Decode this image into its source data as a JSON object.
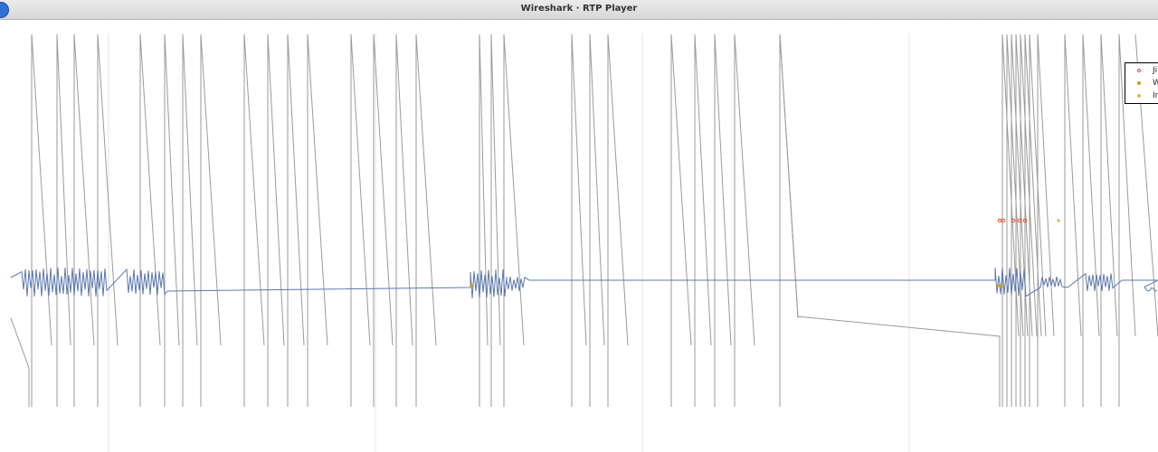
{
  "window": {
    "title": "Wireshark · RTP Player"
  },
  "legend": {
    "items": [
      {
        "label": "Ji",
        "color": "#e05030",
        "marker": "circle-outline"
      },
      {
        "label": "W",
        "color": "#c8a020",
        "marker": "dot"
      },
      {
        "label": "In",
        "color": "#e8b840",
        "marker": "dot"
      }
    ]
  },
  "colors": {
    "sequence_line": "#9a9a9a",
    "waveform": "#5b78b0",
    "grid": "#e4e4e4",
    "jitter_marker": "#e05030",
    "wrong_seq_marker": "#c8a020",
    "inserted_marker": "#e8b840"
  }
}
